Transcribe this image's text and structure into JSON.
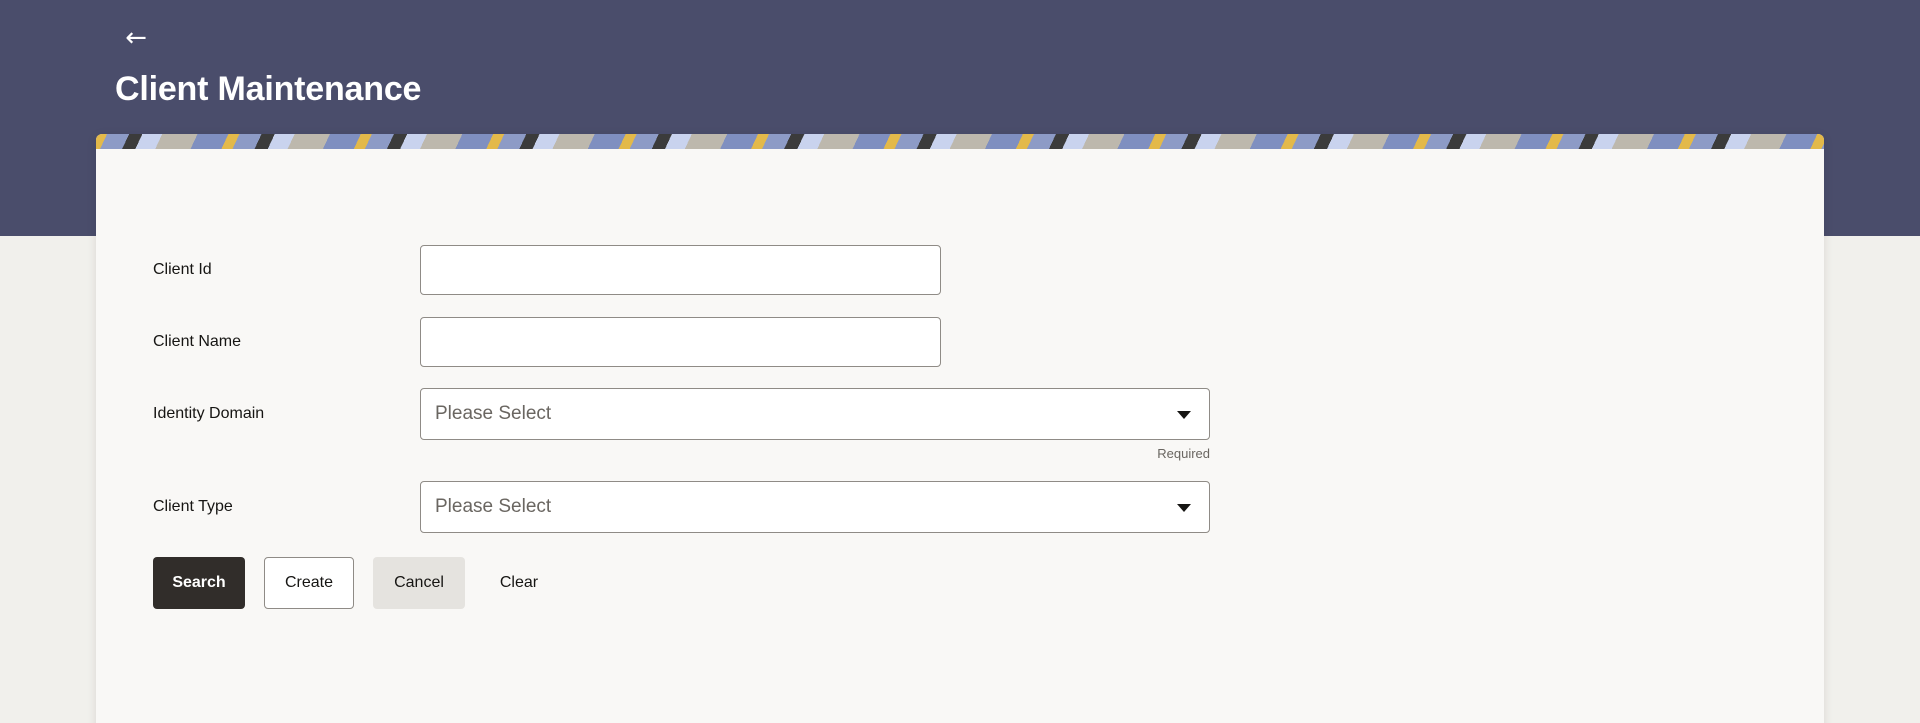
{
  "header": {
    "back_label": "←",
    "title": "Client Maintenance"
  },
  "form": {
    "client_id": {
      "label": "Client Id",
      "value": "",
      "placeholder": ""
    },
    "client_name": {
      "label": "Client Name",
      "value": "",
      "placeholder": ""
    },
    "identity_domain": {
      "label": "Identity Domain",
      "selected": "Please Select",
      "helper": "Required"
    },
    "client_type": {
      "label": "Client Type",
      "selected": "Please Select"
    }
  },
  "actions": {
    "search": "Search",
    "create": "Create",
    "cancel": "Cancel",
    "clear": "Clear"
  },
  "colors": {
    "header_bg": "#4a4d6b",
    "primary_button": "#312d2a",
    "card_bg": "#f9f8f6"
  },
  "icons": {
    "back": "arrow-left-icon",
    "dropdown": "caret-down-icon"
  }
}
